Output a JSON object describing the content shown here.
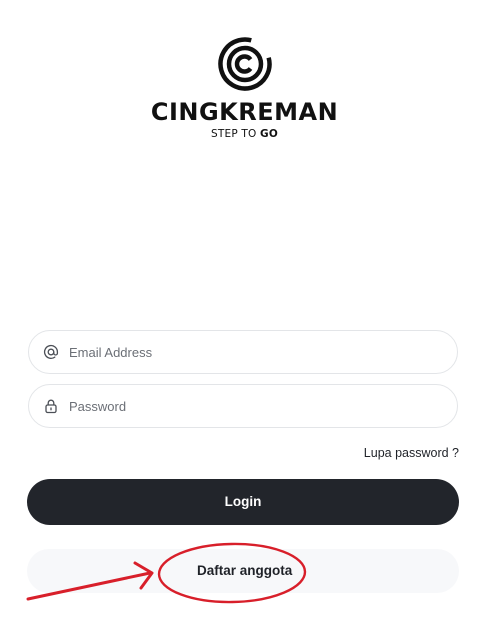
{
  "brand": {
    "name": "CINGKREMAN",
    "tagline_prefix": "STEP TO ",
    "tagline_bold": "GO"
  },
  "form": {
    "email_placeholder": "Email Address",
    "email_value": "",
    "password_placeholder": "Password",
    "password_value": "",
    "forgot_label": "Lupa password ?",
    "login_label": "Login",
    "register_label": "Daftar anggota"
  },
  "icons": {
    "logo": "circular-c-logo-icon",
    "email": "at-sign-icon",
    "password": "lock-icon",
    "annotation_arrow": "red-arrow-icon",
    "annotation_circle": "red-circle-highlight"
  },
  "colors": {
    "primary_button": "#22252b",
    "secondary_button": "#f7f8fa",
    "annotation": "#d81f2a",
    "field_border": "#e3e5e8"
  }
}
